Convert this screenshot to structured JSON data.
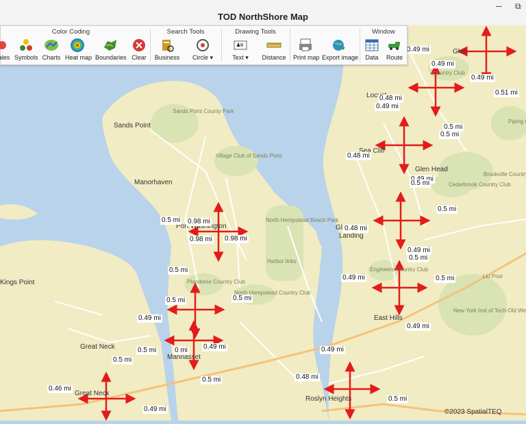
{
  "window": {
    "title": "TOD NorthShore Map",
    "minimize_glyph": "─",
    "restore_glyph": "⧉"
  },
  "ribbon": {
    "groups": [
      {
        "title": "Color Coding",
        "tools": [
          {
            "label": "ales",
            "icon": "ales-icon"
          },
          {
            "label": "Symbols",
            "icon": "symbols-icon"
          },
          {
            "label": "Charts",
            "icon": "charts-icon"
          },
          {
            "label": "Heat map",
            "icon": "heat-map-icon"
          },
          {
            "label": "Boundaries",
            "icon": "boundaries-icon"
          },
          {
            "label": "Clear",
            "icon": "clear-icon"
          }
        ]
      },
      {
        "title": "Search Tools",
        "tools": [
          {
            "label": "Business",
            "icon": "business-icon"
          },
          {
            "label": "Circle ▾",
            "icon": "circle-icon"
          }
        ]
      },
      {
        "title": "Drawing Tools",
        "tools": [
          {
            "label": "Text ▾",
            "icon": "text-icon"
          },
          {
            "label": "Distance",
            "icon": "distance-icon"
          }
        ]
      },
      {
        "title": "",
        "tools": [
          {
            "label": "Print map",
            "icon": "print-map-icon"
          },
          {
            "label": "Export image",
            "icon": "export-image-icon"
          }
        ]
      },
      {
        "title": "Window",
        "tools": [
          {
            "label": "Data",
            "icon": "data-icon"
          },
          {
            "label": "Route",
            "icon": "route-icon"
          }
        ]
      }
    ]
  },
  "map": {
    "places": [
      "Sands Point",
      "Manorhaven",
      "Kings Point",
      "Great Neck",
      "Mannasset",
      "Great Neck",
      "Sea Cliff",
      "Glen Head",
      "East Hills",
      "Roslyn Heights",
      "Glen",
      "Locust",
      "Gle",
      "Gl",
      "Landing",
      "Port Washington",
      "Liu Post"
    ],
    "small_places": [
      "Sands Point County Park",
      "Village Club of Sands Point",
      "North Hempstead Beach Park",
      "Harbor links",
      "Plandome Country Club",
      "North Hempstead Country Club",
      "Cedarbrook Country Club",
      "Brookville Country Club",
      "Engineers Country Club",
      "New York Inst of Tech-Old Westbury",
      "Piping Country",
      "Country Club"
    ],
    "distances": [
      "0.49 mi",
      "0.49 mi",
      "0.49 mi",
      "0.51 mi",
      "0.48 mi",
      "0.49 mi",
      "0.5 mi",
      "0.5 mi",
      "0.48 mi",
      "0.49 mi",
      "0.5 mi",
      "0.5 mi",
      "0.48 mi",
      "0.49 mi",
      "0.5 mi",
      "0.49 mi",
      "0.5 mi",
      "0.49 mi",
      "0.5 mi",
      "0.98 mi",
      "0.98 mi",
      "0.98 mi",
      "0.5 mi",
      "0.5 mi",
      "0.5 mi",
      "0.49 mi",
      "0.5 mi",
      "0 mi",
      "0.49 mi",
      "0.5 mi",
      "0.5 mi",
      "0.49 mi",
      "0.48 mi",
      "0.46 mi",
      "0.49 mi",
      "0.5 mi"
    ],
    "copyright": "©2023 SpatialTEQ",
    "colors": {
      "land": "#f1ecc3",
      "water": "#b9d3ea",
      "park": "#d9e3b4",
      "road": "#ffffff",
      "highway": "#f5c27a",
      "arrow": "#e31b1b"
    }
  }
}
